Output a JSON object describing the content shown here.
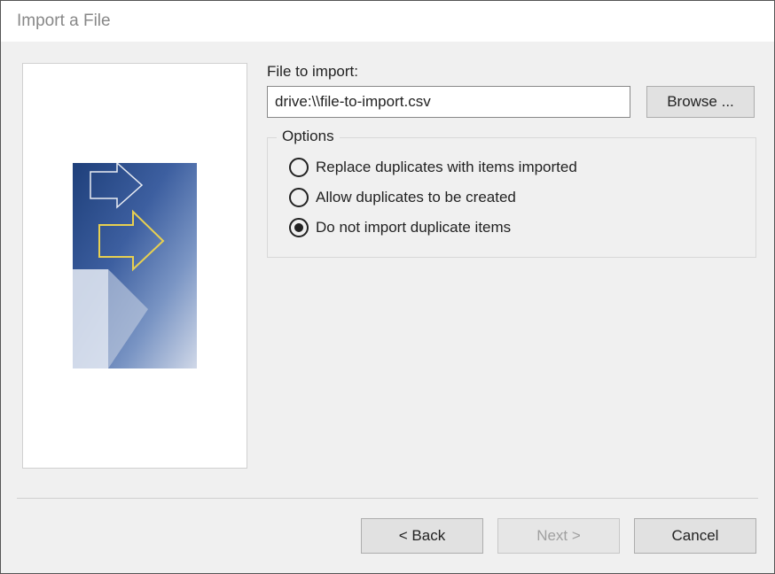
{
  "window": {
    "title": "Import a File"
  },
  "form": {
    "file_label": "File to import:",
    "file_value": "drive:\\\\file-to-import.csv",
    "browse_label": "Browse ..."
  },
  "options": {
    "legend": "Options",
    "items": [
      {
        "label": "Replace duplicates with items imported",
        "selected": false
      },
      {
        "label": "Allow duplicates to be created",
        "selected": false
      },
      {
        "label": "Do not import duplicate items",
        "selected": true
      }
    ]
  },
  "buttons": {
    "back": "< Back",
    "next": "Next >",
    "next_enabled": false,
    "cancel": "Cancel"
  }
}
